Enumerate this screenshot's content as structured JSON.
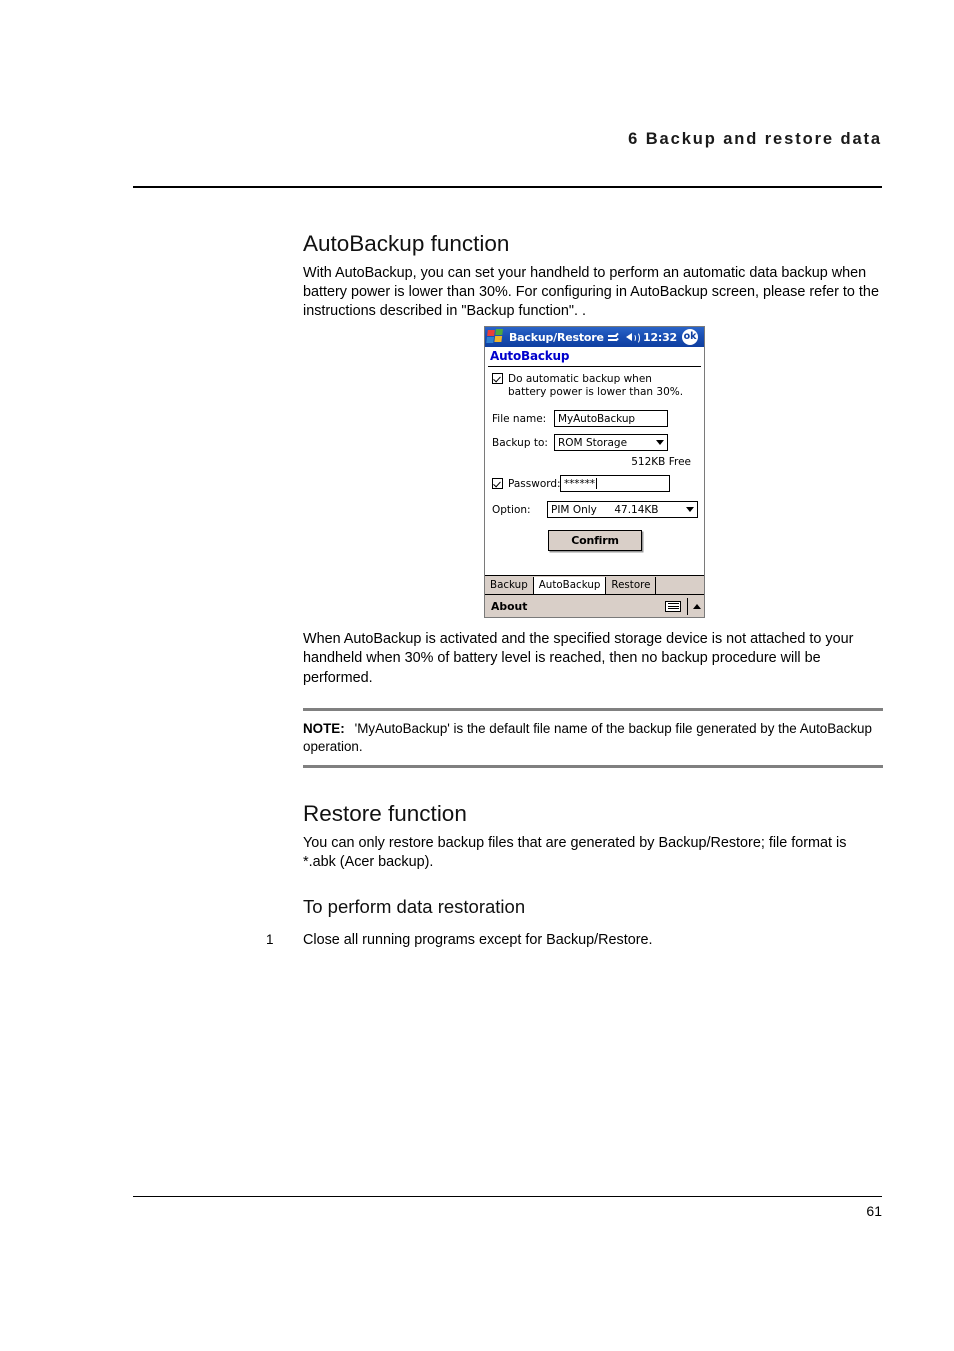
{
  "page": {
    "running_header": "6 Backup and restore data",
    "number": "61"
  },
  "sections": {
    "autobackup": {
      "title": "AutoBackup function",
      "intro": "With AutoBackup, you can set your handheld to perform an automatic data backup when battery power is lower than 30%. For configuring in AutoBackup screen, please refer to the instructions described in \"Backup function\". .",
      "after_image": "When AutoBackup is activated and the specified storage device is not attached to your handheld when 30% of battery level is reached, then no backup procedure will be performed.",
      "note": {
        "label": "NOTE:",
        "text": "'MyAutoBackup' is the default file name of the backup file generated by the AutoBackup operation."
      }
    },
    "restore": {
      "title": "Restore function",
      "intro": "You can only restore backup files that are generated by Backup/Restore; file format is *.abk (Acer backup).",
      "subheading": "To perform data restoration",
      "steps": [
        {
          "number": "1",
          "text": "Close all running programs except for Backup/Restore."
        }
      ]
    }
  },
  "pda_screenshot": {
    "titlebar": {
      "app_title": "Backup/Restore",
      "clock": "12:32",
      "ok_label": "ok",
      "icons": [
        "windows-flag-icon",
        "connectivity-icon",
        "speaker-icon"
      ]
    },
    "app_heading": "AutoBackup",
    "auto_checkbox": {
      "checked": true,
      "label": "Do automatic backup when battery power is lower than 30%."
    },
    "fields": {
      "file_name_label": "File name:",
      "file_name_value": "MyAutoBackup",
      "backup_to_label": "Backup to:",
      "backup_to_value": "ROM Storage",
      "free_space": "512KB Free",
      "password_label": "Password:",
      "password_checked": true,
      "password_value": "******",
      "option_label": "Option:",
      "option_value": "PIM Only",
      "option_size": "47.14KB"
    },
    "confirm_label": "Confirm",
    "tabs": [
      {
        "label": "Backup",
        "active": false
      },
      {
        "label": "AutoBackup",
        "active": true
      },
      {
        "label": "Restore",
        "active": false
      }
    ],
    "command_bar": {
      "about_label": "About",
      "keyboard_icon": "keyboard-icon",
      "up_arrow_icon": "chevron-up-icon"
    }
  },
  "colors": {
    "titlebar_blue": "#1a4fb4",
    "app_heading_blue": "#0000CC",
    "chrome_beige": "#D9CFC8",
    "note_bar_gray": "#808080"
  }
}
